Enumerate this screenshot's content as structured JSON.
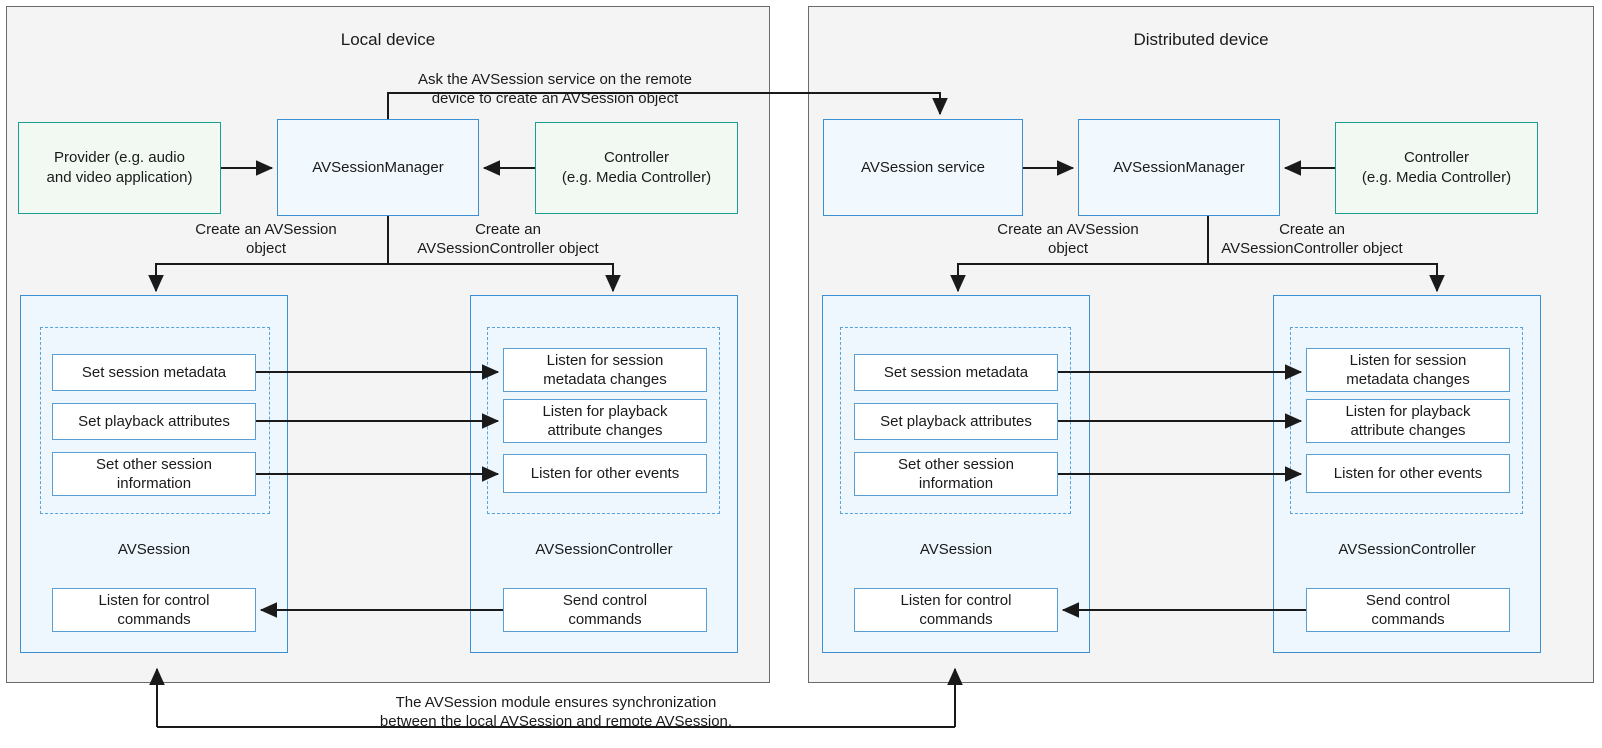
{
  "panels": [
    {
      "id": "local",
      "title": "Local device"
    },
    {
      "id": "distributed",
      "title": "Distributed device"
    }
  ],
  "local": {
    "provider": "Provider (e.g. audio\nand video application)",
    "manager": "AVSessionManager",
    "controller": "Controller\n(e.g. Media Controller)",
    "create_session_label": "Create an AVSession\nobject",
    "create_controller_label": "Create an\nAVSessionController object",
    "session_group": "AVSession",
    "controller_group": "AVSessionController",
    "session_items": [
      "Set session metadata",
      "Set playback attributes",
      "Set other session\ninformation"
    ],
    "controller_items": [
      "Listen for session\nmetadata changes",
      "Listen for playback\nattribute changes",
      "Listen for other events"
    ],
    "listen_control": "Listen for control\ncommands",
    "send_control": "Send control\ncommands"
  },
  "distributed": {
    "service": "AVSession service",
    "manager": "AVSessionManager",
    "controller": "Controller\n(e.g. Media Controller)",
    "create_session_label": "Create an AVSession\nobject",
    "create_controller_label": "Create an\nAVSessionController object",
    "session_group": "AVSession",
    "controller_group": "AVSessionController",
    "session_items": [
      "Set session metadata",
      "Set playback attributes",
      "Set other session\ninformation"
    ],
    "controller_items": [
      "Listen for session\nmetadata changes",
      "Listen for playback\nattribute changes",
      "Listen for other events"
    ],
    "listen_control": "Listen for control\ncommands",
    "send_control": "Send control\ncommands"
  },
  "annotations": {
    "remote_request": "Ask the AVSession service on the remote\ndevice to create an AVSession object",
    "sync_note": "The AVSession module ensures synchronization\nbetween the local AVSession and remote AVSession."
  },
  "colors": {
    "panel_border": "#6b6b6b",
    "panel_fill": "#f4f4f4",
    "green_border": "#1a9e8f",
    "green_fill": "#f2f9f3",
    "blue_border": "#3d8fd4",
    "blue_fill": "#f2f9fe",
    "container_fill": "#eef7fd",
    "dashed_border": "#57a3dd",
    "arrow": "#1a1a1a"
  }
}
